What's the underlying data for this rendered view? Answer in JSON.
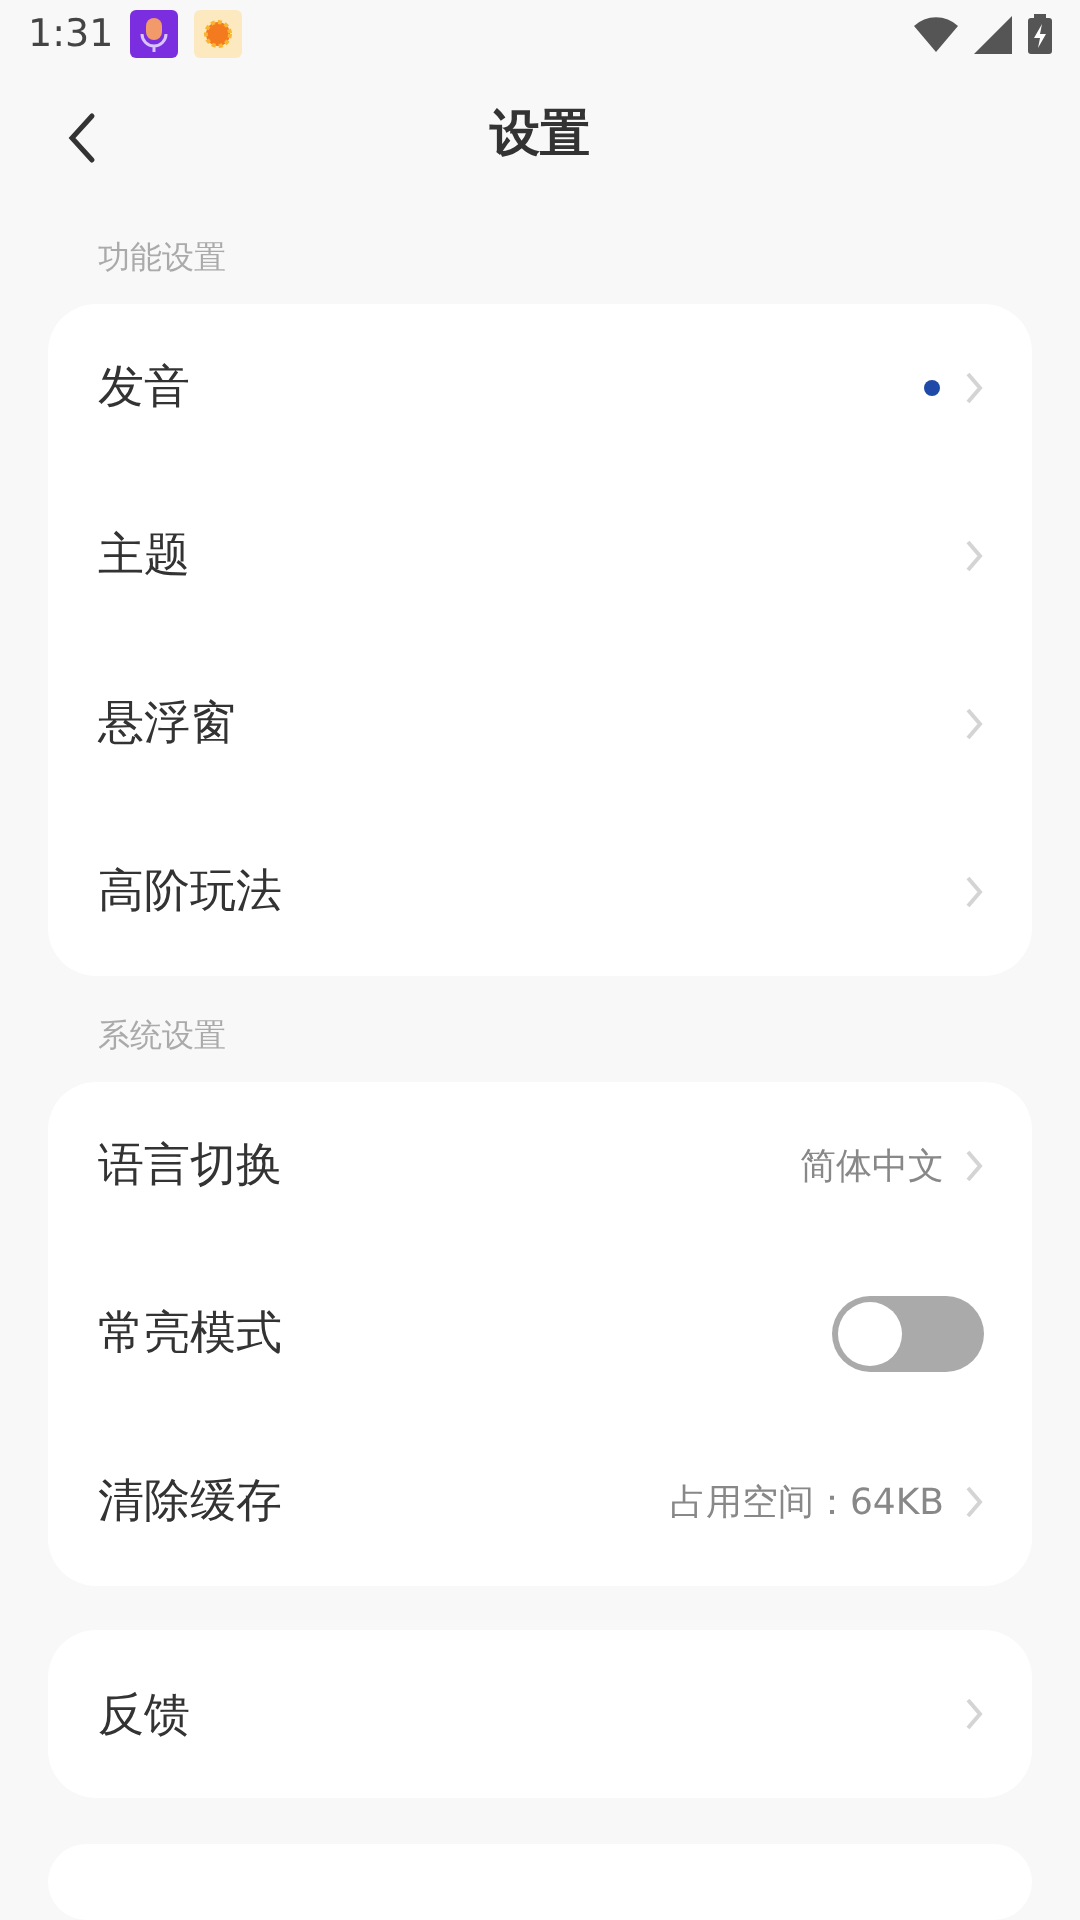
{
  "status_bar": {
    "time": "1:31"
  },
  "header": {
    "title": "设置"
  },
  "sections": [
    {
      "label": "功能设置",
      "rows": [
        {
          "kind": "link",
          "label": "发音",
          "dot": true
        },
        {
          "kind": "link",
          "label": "主题",
          "dot": false
        },
        {
          "kind": "link",
          "label": "悬浮窗",
          "dot": false
        },
        {
          "kind": "link",
          "label": "高阶玩法",
          "dot": false
        }
      ]
    },
    {
      "label": "系统设置",
      "rows": [
        {
          "kind": "link",
          "label": "语言切换",
          "value": "简体中文",
          "dot": false
        },
        {
          "kind": "toggle",
          "label": "常亮模式",
          "on": false
        },
        {
          "kind": "link",
          "label": "清除缓存",
          "value": "占用空间：64KB",
          "dot": false
        }
      ]
    },
    {
      "rows": [
        {
          "kind": "link",
          "label": "反馈",
          "dot": false
        }
      ]
    }
  ]
}
